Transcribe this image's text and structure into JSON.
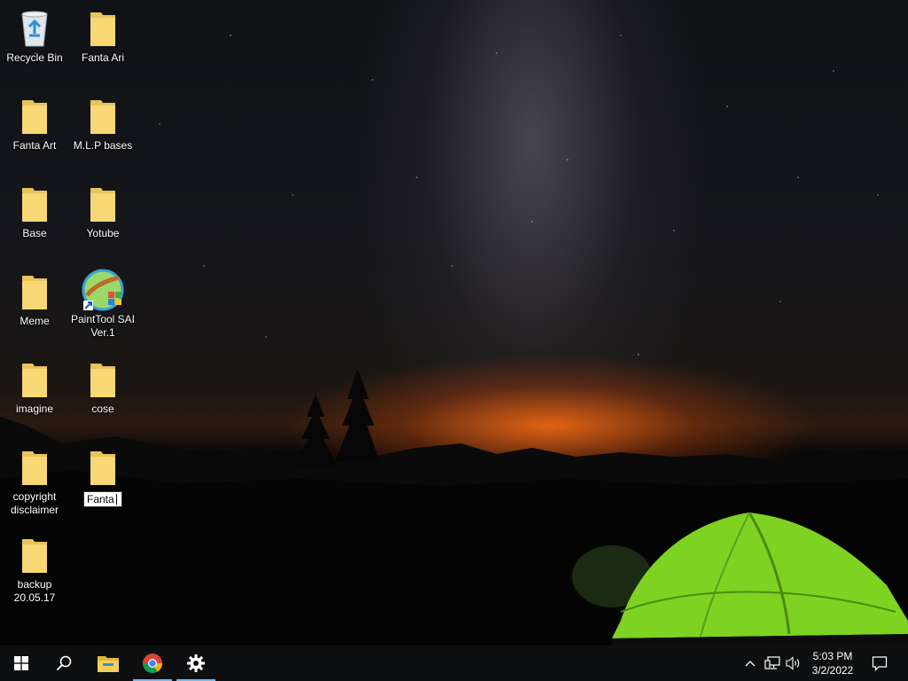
{
  "desktop": {
    "icons": [
      {
        "label": "Recycle Bin",
        "icon": "recycle-bin-icon"
      },
      {
        "label": "Fanta Ari",
        "icon": "folder-icon"
      },
      {
        "label": "Fanta Art",
        "icon": "folder-icon"
      },
      {
        "label": "M.L.P bases",
        "icon": "folder-icon"
      },
      {
        "label": "Base",
        "icon": "folder-icon"
      },
      {
        "label": "Yotube",
        "icon": "folder-icon"
      },
      {
        "label": "Meme",
        "icon": "folder-icon"
      },
      {
        "label": "PaintTool SAI Ver.1",
        "icon": "painttool-sai-icon"
      },
      {
        "label": "imagine",
        "icon": "folder-icon"
      },
      {
        "label": "cose",
        "icon": "folder-icon"
      },
      {
        "label": "copyright disclaimer",
        "icon": "folder-icon"
      },
      {
        "label": "Fanta",
        "icon": "folder-icon",
        "renaming": true
      },
      {
        "label": "backup 20.05.17",
        "icon": "folder-icon"
      }
    ]
  },
  "taskbar": {
    "start": "windows-start-icon",
    "search": "search-icon",
    "pinned": [
      {
        "name": "file-explorer",
        "icon": "folder-icon",
        "active": false
      },
      {
        "name": "chrome",
        "icon": "chrome-icon",
        "active": true
      },
      {
        "name": "settings",
        "icon": "gear-icon",
        "active": true
      }
    ],
    "tray_icons": [
      "chevron-up-icon",
      "network-icon",
      "volume-icon"
    ],
    "time": "5:03 PM",
    "date": "3/2/2022",
    "notification": "action-center-icon",
    "accent_color": "#76b9ed"
  }
}
